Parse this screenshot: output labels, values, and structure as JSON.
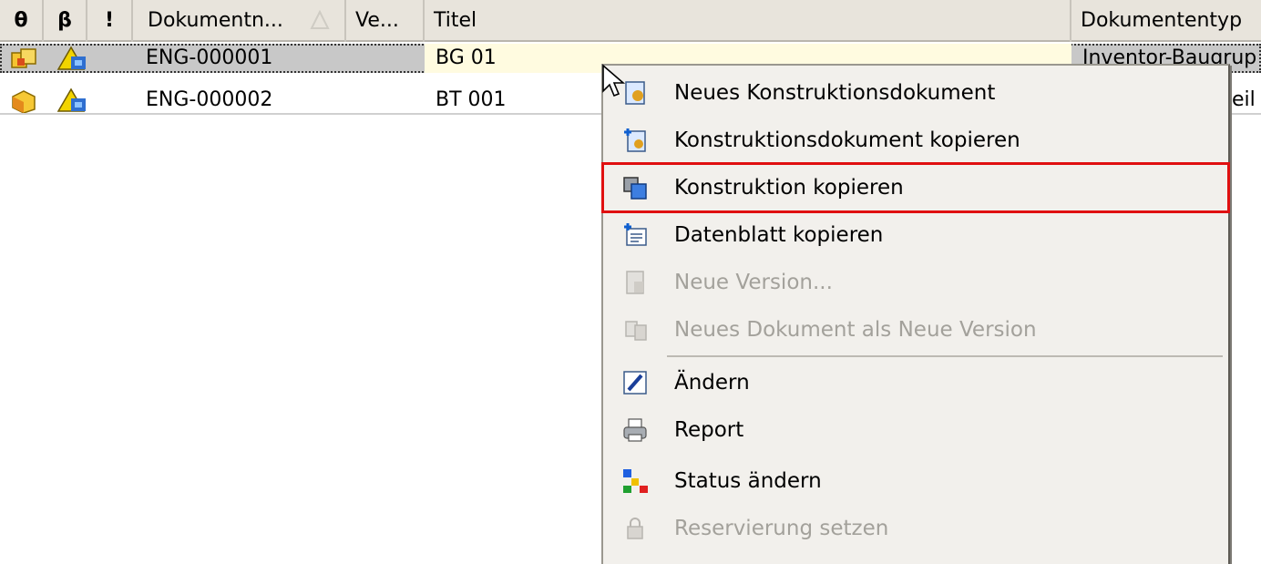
{
  "header": {
    "col_attach": "θ",
    "col_lock": "β",
    "col_priority": "!",
    "col_docnum": "Dokumentn...",
    "col_version": "Ve...",
    "col_title": "Titel",
    "col_doctype": "Dokumententyp"
  },
  "rows": [
    {
      "docnum": "ENG-000001",
      "title": "BG 01",
      "doctype": "Inventor-Baugrup"
    },
    {
      "docnum": "ENG-000002",
      "title": "BT 001",
      "doctype": "eil"
    }
  ],
  "menu": {
    "items": [
      {
        "label": "Neues Konstruktionsdokument",
        "icon": "new-document-icon",
        "enabled": true
      },
      {
        "label": "Konstruktionsdokument kopieren",
        "icon": "copy-document-icon",
        "enabled": true
      },
      {
        "label": "Konstruktion kopieren",
        "icon": "copy-design-icon",
        "enabled": true,
        "highlighted": true
      },
      {
        "label": "Datenblatt kopieren",
        "icon": "copy-datasheet-icon",
        "enabled": true
      },
      {
        "label": "Neue Version...",
        "icon": "new-version-icon",
        "enabled": false
      },
      {
        "label": "Neues Dokument als Neue Version",
        "icon": "new-doc-as-version-icon",
        "enabled": false
      },
      {
        "label": "Ändern",
        "icon": "edit-pencil-icon",
        "enabled": true
      },
      {
        "label": "Report",
        "icon": "printer-icon",
        "enabled": true
      },
      {
        "label": "Status ändern",
        "icon": "status-workflow-icon",
        "enabled": true
      },
      {
        "label": "Reservierung setzen",
        "icon": "lock-icon",
        "enabled": false
      }
    ]
  },
  "colors": {
    "highlight_border": "#e01010",
    "selected_row": "#c8c8c8",
    "title_cell_bg": "#fffbe0",
    "disabled_text": "#a3a19b"
  }
}
